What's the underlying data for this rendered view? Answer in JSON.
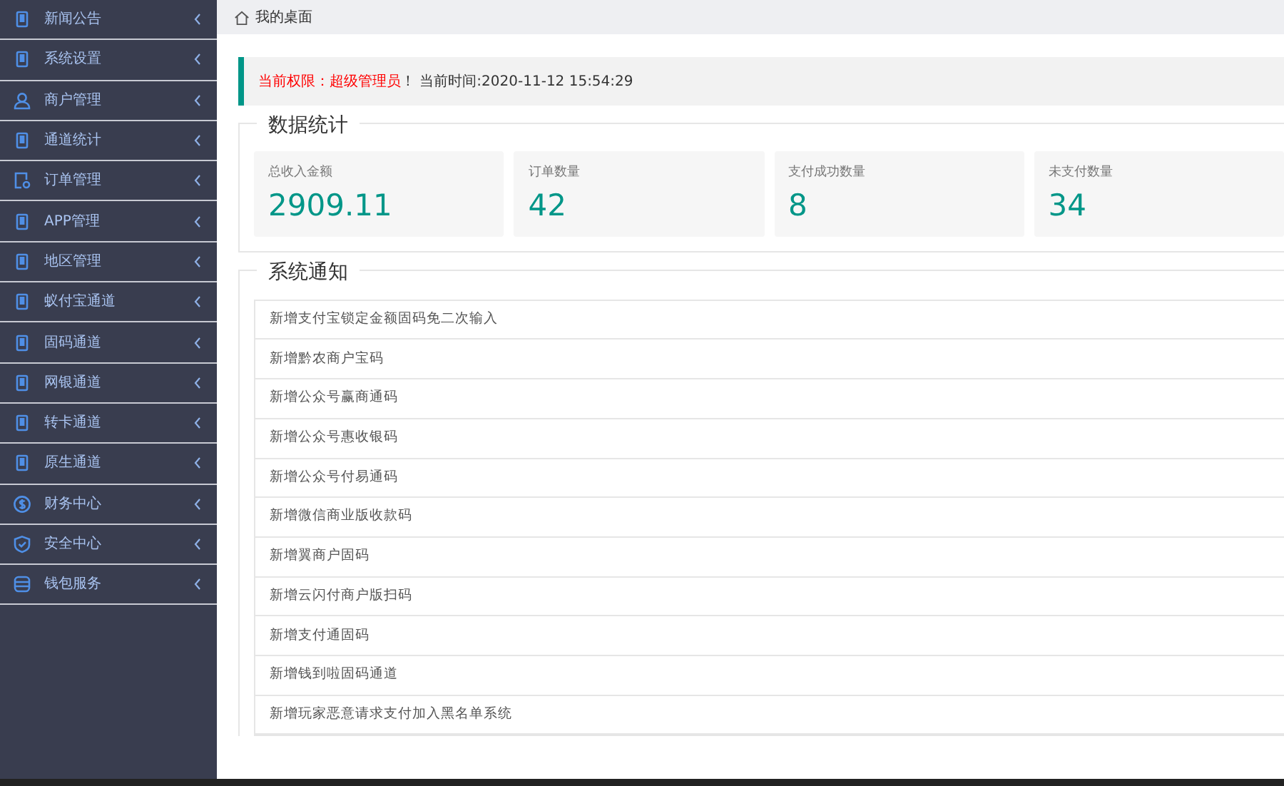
{
  "sidebar": {
    "items": [
      {
        "label": "新闻公告",
        "kind": "phone"
      },
      {
        "label": "系统设置",
        "kind": "phone"
      },
      {
        "label": "商户管理",
        "kind": "user"
      },
      {
        "label": "通道统计",
        "kind": "phone"
      },
      {
        "label": "订单管理",
        "kind": "doc"
      },
      {
        "label": "APP管理",
        "kind": "phone"
      },
      {
        "label": "地区管理",
        "kind": "phone"
      },
      {
        "label": "蚁付宝通道",
        "kind": "phone"
      },
      {
        "label": "固码通道",
        "kind": "phone"
      },
      {
        "label": "网银通道",
        "kind": "phone"
      },
      {
        "label": "转卡通道",
        "kind": "phone"
      },
      {
        "label": "原生通道",
        "kind": "phone"
      },
      {
        "label": "财务中心",
        "kind": "dollar"
      },
      {
        "label": "安全中心",
        "kind": "shield"
      },
      {
        "label": "钱包服务",
        "kind": "database"
      }
    ]
  },
  "breadcrumb": "我的桌面",
  "notice": {
    "role_label": "当前权限：超级管理员",
    "rest": "！ 当前时间:2020-11-12 15:54:29"
  },
  "stats": {
    "title": "数据统计",
    "cards": [
      {
        "label": "总收入金额",
        "value": "2909.11"
      },
      {
        "label": "订单数量",
        "value": "42"
      },
      {
        "label": "支付成功数量",
        "value": "8"
      },
      {
        "label": "未支付数量",
        "value": "34"
      }
    ]
  },
  "announcements": {
    "title": "系统通知",
    "items": [
      "新增支付宝锁定金额固码免二次输入",
      "新增黔农商户宝码",
      "新增公众号赢商通码",
      "新增公众号惠收银码",
      "新增公众号付易通码",
      "新增微信商业版收款码",
      "新增翼商户固码",
      "新增云闪付商户版扫码",
      "新增支付通固码",
      "新增钱到啦固码通道",
      "新增玩家恶意请求支付加入黑名单系统"
    ]
  }
}
